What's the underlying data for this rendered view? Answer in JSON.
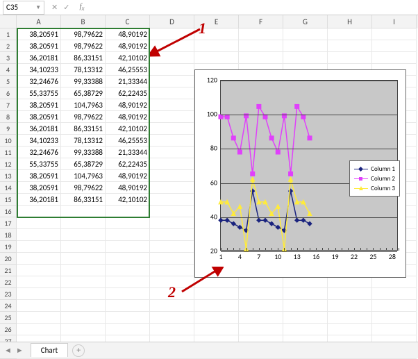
{
  "namebox": {
    "ref": "C35"
  },
  "columns": [
    "A",
    "B",
    "C",
    "D",
    "E",
    "F",
    "G",
    "H",
    "I"
  ],
  "rowcount": 28,
  "table": {
    "rows": [
      [
        "38,20591",
        "98,79622",
        "48,90192"
      ],
      [
        "38,20591",
        "98,79622",
        "48,90192"
      ],
      [
        "36,20181",
        "86,33151",
        "42,10102"
      ],
      [
        "34,10233",
        "78,13312",
        "46,25553"
      ],
      [
        "32,24676",
        "99,33388",
        "21,33344"
      ],
      [
        "55,33755",
        "65,38729",
        "62,22435"
      ],
      [
        "38,20591",
        "104,7963",
        "48,90192"
      ],
      [
        "38,20591",
        "98,79622",
        "48,90192"
      ],
      [
        "36,20181",
        "86,33151",
        "42,10102"
      ],
      [
        "34,10233",
        "78,13312",
        "46,25553"
      ],
      [
        "32,24676",
        "99,33388",
        "21,33344"
      ],
      [
        "55,33755",
        "65,38729",
        "62,22435"
      ],
      [
        "38,20591",
        "104,7963",
        "48,90192"
      ],
      [
        "38,20591",
        "98,79622",
        "48,90192"
      ],
      [
        "36,20181",
        "86,33151",
        "42,10102"
      ]
    ]
  },
  "chart_data": {
    "type": "line",
    "x": [
      1,
      2,
      3,
      4,
      5,
      6,
      7,
      8,
      9,
      10,
      11,
      12,
      13,
      14,
      15
    ],
    "series": [
      {
        "name": "Column 1",
        "color": "#1a237e",
        "marker": "diamond",
        "values": [
          38.21,
          38.21,
          36.2,
          34.1,
          32.25,
          55.34,
          38.21,
          38.21,
          36.2,
          34.1,
          32.25,
          55.34,
          38.21,
          38.21,
          36.2
        ]
      },
      {
        "name": "Column 2",
        "color": "#e040fb",
        "marker": "square",
        "values": [
          98.8,
          98.8,
          86.33,
          78.13,
          99.33,
          65.39,
          104.8,
          98.8,
          86.33,
          78.13,
          99.33,
          65.39,
          104.8,
          98.8,
          86.33
        ]
      },
      {
        "name": "Column 3",
        "color": "#ffeb3b",
        "marker": "triangle",
        "values": [
          48.9,
          48.9,
          42.1,
          46.26,
          21.33,
          62.22,
          48.9,
          48.9,
          42.1,
          46.26,
          21.33,
          62.22,
          48.9,
          48.9,
          42.1
        ]
      }
    ],
    "ylim": [
      20,
      120
    ],
    "yticks": [
      20,
      40,
      60,
      80,
      100,
      120
    ],
    "xlim": [
      1,
      29
    ],
    "xticks": [
      1,
      4,
      7,
      10,
      13,
      16,
      19,
      22,
      25,
      28
    ]
  },
  "legend": {
    "items": [
      "Column 1",
      "Column 2",
      "Column 3"
    ]
  },
  "tabs": {
    "active": "Chart"
  },
  "callouts": {
    "one": "1",
    "two": "2"
  }
}
